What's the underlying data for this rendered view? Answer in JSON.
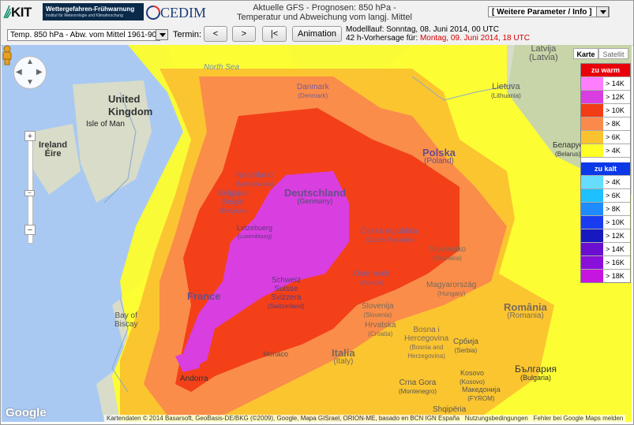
{
  "header": {
    "kit_logo": "KIT",
    "kit_sub": "Wettergefahren-Frühwarnung",
    "kit_sub2": "Institut für Meteorologie und Klimaforschung",
    "cedim_logo": "CEDIM",
    "title_line1": "Aktuelle GFS - Prognosen: 850 hPa -",
    "title_line2": "Temperatur und Abweichung vom langj. Mittel",
    "info_select": "[ Weitere Parameter / Info ]"
  },
  "controls": {
    "param_select": "Temp. 850 hPa - Abw. vom Mittel 1961-90",
    "termin_label": "Termin:",
    "prev_label": "<",
    "next_label": ">",
    "first_label": "|<",
    "animation_label": "Animation",
    "modell_label": "Modelllauf: Sonntag, 08. Juni 2014, 00 UTC",
    "forecast_label": "42 h-Vorhersage für: ",
    "forecast_value": "Montag, 09. Juni 2014, 18 UTC"
  },
  "map": {
    "type_map": "Karte",
    "type_sat": "Satellit",
    "zoom_in": "+",
    "zoom_out": "−",
    "attribution": "Kartendaten © 2014 Basarsoft, GeoBasis-DE/BKG (©2009), Google, Mapa GISrael, ORION-ME, basado en BCN IGN España",
    "terms": "Nutzungsbedingungen",
    "report": "Fehler bei Google Maps melden",
    "google": "Google",
    "places": {
      "latvia": "Latvija",
      "latvia_en": "(Latvia)",
      "lietuva": "Lietuva",
      "lietuva_en": "(Lithuania)",
      "north_sea": "North Sea",
      "uk1": "United",
      "uk2": "Kingdom",
      "isle_of_man": "Isle of Man",
      "ireland": "Ireland",
      "eire": "Éire",
      "danmark": "Danmark",
      "danmark_en": "(Denmark)",
      "polska": "Polska",
      "polska_en": "(Poland)",
      "belarus": "Беларус",
      "belarus_en": "(Belarus)",
      "nederland": "Nederland",
      "nederland_en": "(Netherlands)",
      "belgique": "Belgique",
      "belgie": "België",
      "belgium_en": "(Belgium)",
      "deutschland": "Deutschland",
      "germany_en": "(Germany)",
      "letzebuerg": "Letzebuerg",
      "lux_en": "(Luxembourg)",
      "cesko": "Česká republika",
      "czech_en": "(Czech Republic)",
      "slovensko": "Slovensko",
      "slovakia_en": "(Slovakia)",
      "osterreich": "Österreich",
      "austria_en": "(Austria)",
      "france": "France",
      "schweiz": "Schweiz",
      "suisse": "Suisse",
      "svizzera": "Svizzera",
      "swiss_en": "(Switzerland)",
      "magyar": "Magyarország",
      "hungary_en": "(Hungary)",
      "bay1": "Bay of",
      "bay2": "Biscay",
      "slovenija": "Slovenija",
      "slovenia_en": "(Slovenia)",
      "hrvatska": "Hrvatska",
      "croatia_en": "(Croatia)",
      "bosna1": "Bosna i",
      "bosna2": "Hercegovina",
      "bosna3": "(Bosnia and",
      "bosna4": "Herzegovina)",
      "romania": "România",
      "romania_en": "(Romania)",
      "monaco": "Monaco",
      "italia": "Italia",
      "italy_en": "(Italy)",
      "srbija": "Србија",
      "serbia_en": "(Serbia)",
      "andorra": "Andorra",
      "crna_gora": "Crna Gora",
      "montenegro_en": "(Montenegro)",
      "kosovo": "Kosovo",
      "kosovo2": "(Kosovo)",
      "bulgaria": "България",
      "bulgaria_en": "(Bulgaria)",
      "makedonija": "Македонија",
      "fyrom": "(FYROM)",
      "shqiperia": "Shqipëria"
    }
  },
  "legend": {
    "warm_header": "zu warm",
    "warm_header_color": "#e8000b",
    "warm": [
      {
        "label": "> 14K",
        "color": "#ff7dff"
      },
      {
        "label": "> 12K",
        "color": "#d93ee0"
      },
      {
        "label": "> 10K",
        "color": "#f23c16"
      },
      {
        "label": "> 8K",
        "color": "#fa8a4c"
      },
      {
        "label": "> 6K",
        "color": "#fbc230"
      },
      {
        "label": "> 4K",
        "color": "#ffff28"
      }
    ],
    "cold_header": "zu kalt",
    "cold_header_color": "#0c39e8",
    "cold": [
      {
        "label": "> 4K",
        "color": "#66ddff"
      },
      {
        "label": "> 6K",
        "color": "#1fc0ff"
      },
      {
        "label": "> 8K",
        "color": "#1e8bff"
      },
      {
        "label": "> 10K",
        "color": "#1a3cf0"
      },
      {
        "label": "> 12K",
        "color": "#1719c0"
      },
      {
        "label": "> 14K",
        "color": "#6a0fd0"
      },
      {
        "label": "> 16K",
        "color": "#8a0fd8"
      },
      {
        "label": "> 18K",
        "color": "#c615e0"
      }
    ]
  }
}
